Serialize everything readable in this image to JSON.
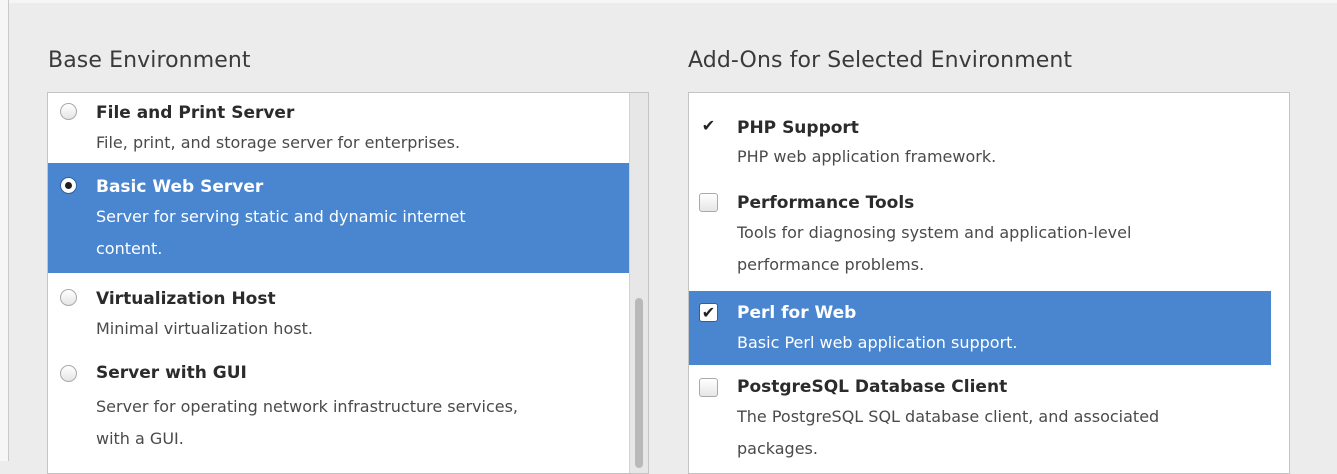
{
  "base": {
    "title": "Base Environment",
    "items": [
      {
        "title": "File and Print Server",
        "desc": "File, print, and storage server for enterprises."
      },
      {
        "title": "Basic Web Server",
        "desc1": "Server for serving static and dynamic internet",
        "desc2": "content."
      },
      {
        "title": "Virtualization Host",
        "desc": "Minimal virtualization host."
      },
      {
        "title": "Server with GUI",
        "desc1": "Server for operating network infrastructure services,",
        "desc2": "with a GUI."
      }
    ]
  },
  "addons": {
    "title": "Add-Ons for Selected Environment",
    "items": [
      {
        "title": "PHP Support",
        "desc": "PHP web application framework.",
        "checked": true
      },
      {
        "title": "Performance Tools",
        "desc1": "Tools for diagnosing system and application-level",
        "desc2": "performance problems.",
        "checked": false
      },
      {
        "title": "Perl for Web",
        "desc": "Basic Perl web application support.",
        "checked": true
      },
      {
        "title": "PostgreSQL Database Client",
        "desc1": "The PostgreSQL SQL database client, and associated",
        "desc2": "packages.",
        "checked": false
      }
    ]
  },
  "colors": {
    "selection": "#4a86cf",
    "background": "#ececec"
  },
  "icons": {
    "check": "✔"
  }
}
